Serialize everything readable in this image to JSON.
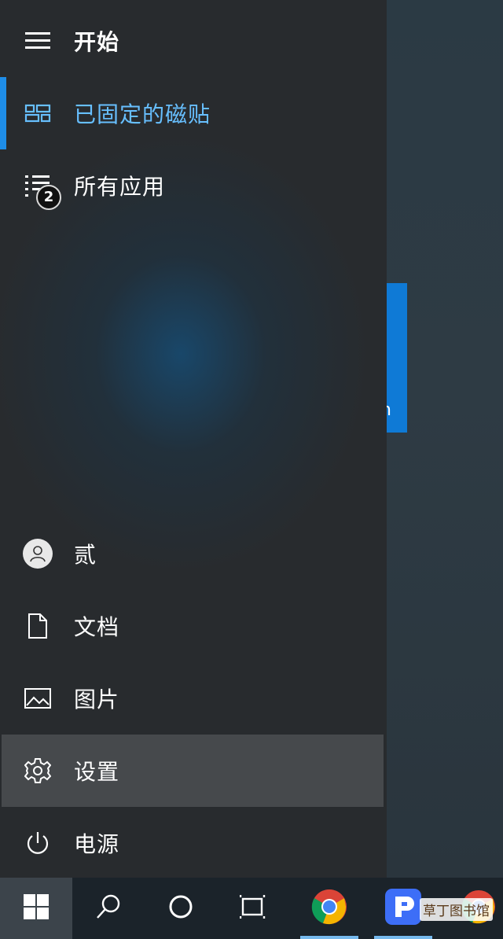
{
  "start_menu": {
    "title": "开始",
    "pinned_tiles_label": "已固定的磁贴",
    "all_apps_label": "所有应用",
    "all_apps_badge": "2",
    "user_label": "贰",
    "documents_label": "文档",
    "pictures_label": "图片",
    "settings_label": "设置",
    "power_label": "电源"
  },
  "desktop": {
    "tile_partial_text": "n"
  },
  "taskbar": {
    "icons": [
      "windows-start-icon",
      "search-icon",
      "cortana-icon",
      "task-view-icon",
      "chrome-icon",
      "app-icon",
      "chrome-icon"
    ]
  },
  "watermark": "草丁图书馆",
  "colors": {
    "accent": "#1e8de8",
    "selected_text": "#67bfff",
    "hover_row": "#46494c"
  }
}
